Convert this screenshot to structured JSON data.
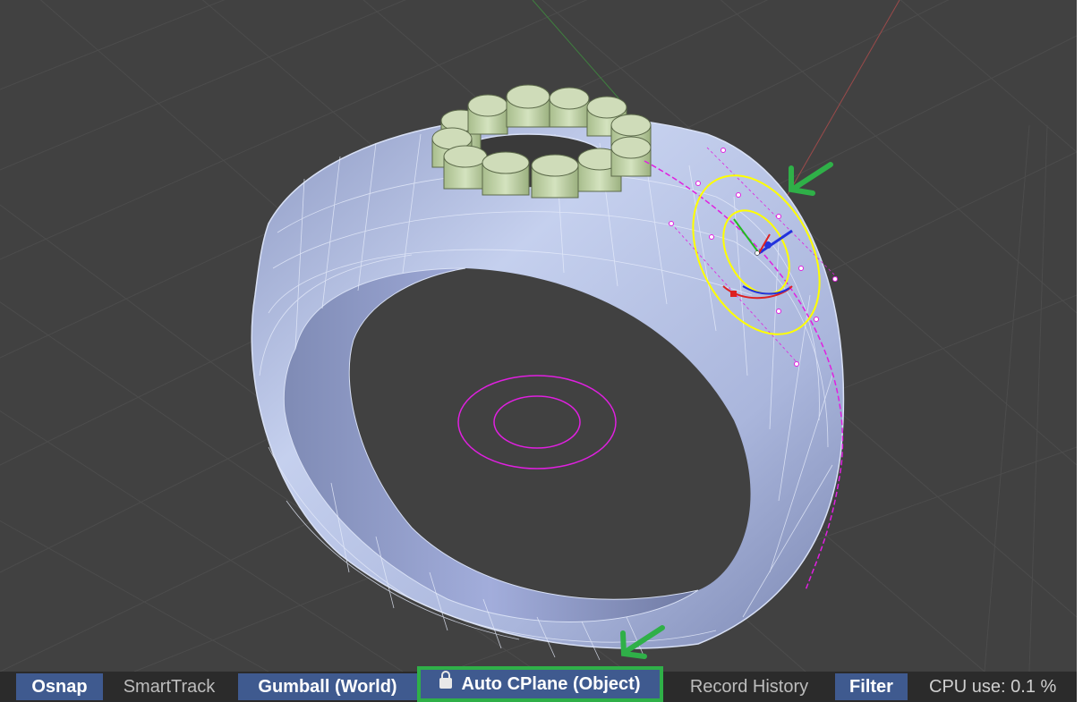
{
  "statusbar": {
    "osnap": "Osnap",
    "smarttrack": "SmartTrack",
    "gumball": "Gumball (World)",
    "auto_cplane": "Auto CPlane (Object)",
    "record_history": "Record History",
    "filter": "Filter",
    "cpu": "CPU use: 0.1 %"
  },
  "viewport": {
    "background_color": "#414141",
    "ring_color": "#b3c0e0",
    "gem_color": "#c3d6ab",
    "curve_color": "#e020e0",
    "circle_color": "#ffff00",
    "annotation_arrow_color": "#2fb048"
  }
}
